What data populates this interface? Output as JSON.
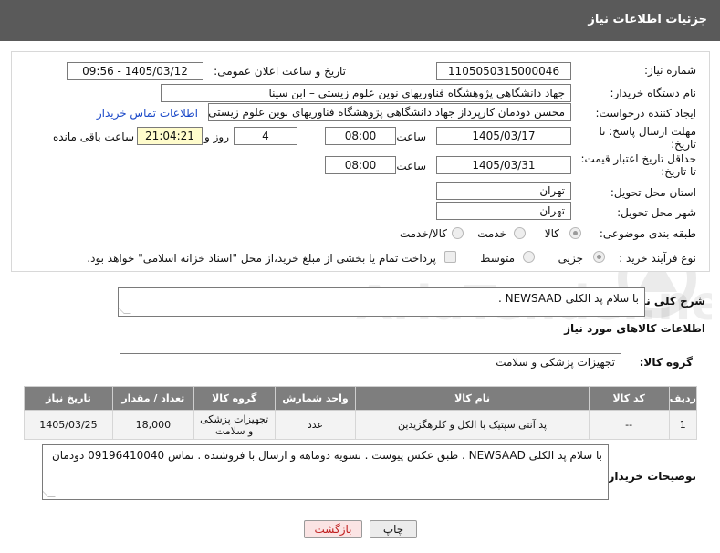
{
  "header": {
    "title": "جزئیات اطلاعات نیاز"
  },
  "form": {
    "need_number_label": "شماره نیاز:",
    "need_number": "1105050315000046",
    "announce_label": "تاریخ و ساعت اعلان عمومی:",
    "announce_value": "1405/03/12 - 09:56",
    "buyer_org_label": "نام دستگاه خریدار:",
    "buyer_org": "جهاد دانشگاهی پژوهشگاه فناوریهای نوین علوم زیستی – ابن سینا",
    "requester_label": "ایجاد کننده درخواست:",
    "requester": "محسن دودمان کارپرداز جهاد دانشگاهی پژوهشگاه فناوریهای نوین علوم زیستی",
    "contact_link": "اطلاعات تماس خریدار",
    "reply_deadline_label_1": "مهلت ارسال پاسخ: تا",
    "reply_deadline_label_2": "تاریخ:",
    "reply_date": "1405/03/17",
    "time_label": "ساعت",
    "reply_time": "08:00",
    "days_value": "4",
    "days_and_label": "روز و",
    "remaining_time": "21:04:21",
    "remaining_label": "ساعت باقی مانده",
    "price_validity_label_1": "حداقل تاریخ اعتبار قیمت:",
    "price_validity_label_2": "تا تاریخ:",
    "price_date": "1405/03/31",
    "price_time": "08:00",
    "province_label": "استان محل تحویل:",
    "province": "تهران",
    "city_label": "شهر محل تحویل:",
    "city": "تهران",
    "category_label": "طبقه بندی موضوعی:",
    "category_options": [
      "کالا",
      "خدمت",
      "کالا/خدمت"
    ],
    "purchase_type_label": "نوع فرآیند خرید :",
    "purchase_options": [
      "جزیی",
      "متوسط"
    ],
    "payment_note": "پرداخت تمام یا بخشی از مبلغ خرید،از محل \"اسناد خزانه اسلامی\" خواهد بود."
  },
  "summary": {
    "label": "شرح کلی نیاز:",
    "text": "با سلام پد الکلی  NEWSAAD ."
  },
  "goods": {
    "section_title": "اطلاعات کالاهای مورد نیاز",
    "group_label": "گروه کالا:",
    "group_value": "تجهیزات پزشکی و سلامت",
    "columns": [
      "ردیف",
      "کد کالا",
      "نام کالا",
      "واحد شمارش",
      "گروه کالا",
      "تعداد / مقدار",
      "تاریخ نیاز"
    ],
    "rows": [
      [
        "1",
        "--",
        "پد آنتی سپتیک با الکل و کلرهگزیدین",
        "عدد",
        "تجهیزات پزشکی و سلامت",
        "18,000",
        "1405/03/25"
      ]
    ]
  },
  "buyer_notes": {
    "label": "توضیحات خریدار:",
    "text": "با سلام پد الکلی  NEWSAAD . طبق عکس پیوست . تسویه دوماهه و ارسال با فروشنده . تماس 09196410040 دودمان"
  },
  "buttons": {
    "print": "چاپ",
    "back": "بازگشت"
  },
  "watermark": {
    "text": "AriaTender.net"
  }
}
